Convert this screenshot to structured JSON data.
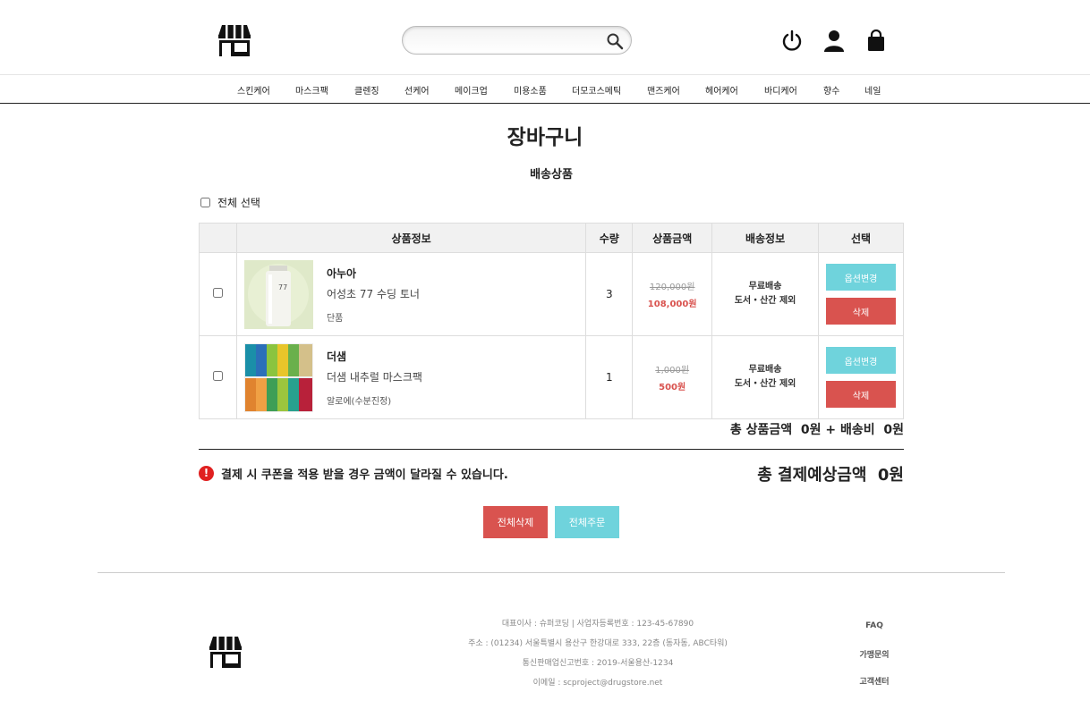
{
  "header": {
    "search_placeholder": "",
    "icons": [
      "store-logo-icon",
      "search-icon",
      "power-icon",
      "user-icon",
      "shopping-bag-icon"
    ]
  },
  "categories": [
    "스킨케어",
    "마스크팩",
    "클렌징",
    "선케어",
    "메이크업",
    "미용소품",
    "더모코스메틱",
    "맨즈케어",
    "헤어케어",
    "바디케어",
    "향수",
    "네일"
  ],
  "page": {
    "title": "장바구니",
    "subtitle": "배송상품",
    "select_all": "전체 선택"
  },
  "table": {
    "headers": [
      "",
      "상품정보",
      "수량",
      "상품금액",
      "배송정보",
      "선택"
    ],
    "rows": [
      {
        "brand": "아누아",
        "name": "어성초 77 수딩 토너",
        "option": "단품",
        "qty": "3",
        "old_price": "120,000원",
        "new_price": "108,000원",
        "ship1": "무료배송",
        "ship2": "도서・산간 제외",
        "btn_option": "옵션변경",
        "btn_delete": "삭제"
      },
      {
        "brand": "더샘",
        "name": "더샘 내추럴 마스크팩",
        "option": "알로에(수분진정)",
        "qty": "1",
        "old_price": "1,000원",
        "new_price": "500원",
        "ship1": "무료배송",
        "ship2": "도서・산간 제외",
        "btn_option": "옵션변경",
        "btn_delete": "삭제"
      }
    ]
  },
  "summary": {
    "total_line": "총 상품금액  0원 + 배송비  0원",
    "notice": "결제 시 쿠폰을 적용 받을 경우 금액이 달라질 수 있습니다.",
    "notice_icon": "!",
    "grand_total": "총 결제예상금액  0원",
    "delete_all": "전체삭제",
    "order_all": "전체주문"
  },
  "footer": {
    "line1": "대표이사 : 슈퍼코딩 | 사업자등록번호 : 123-45-67890",
    "line2": "주소 : (01234) 서울특별시 용산구 한강대로 333, 22층 (동자동, ABC타워)",
    "line3": "통신판매업신고번호 : 2019-서울용산-1234",
    "line4": "이메일 : scproject@drugstore.net",
    "links": [
      "FAQ",
      "가맹문의",
      "고객센터"
    ]
  },
  "colors": {
    "teal": "#6fd3dc",
    "red": "#d9534f",
    "alert": "#e02020"
  }
}
